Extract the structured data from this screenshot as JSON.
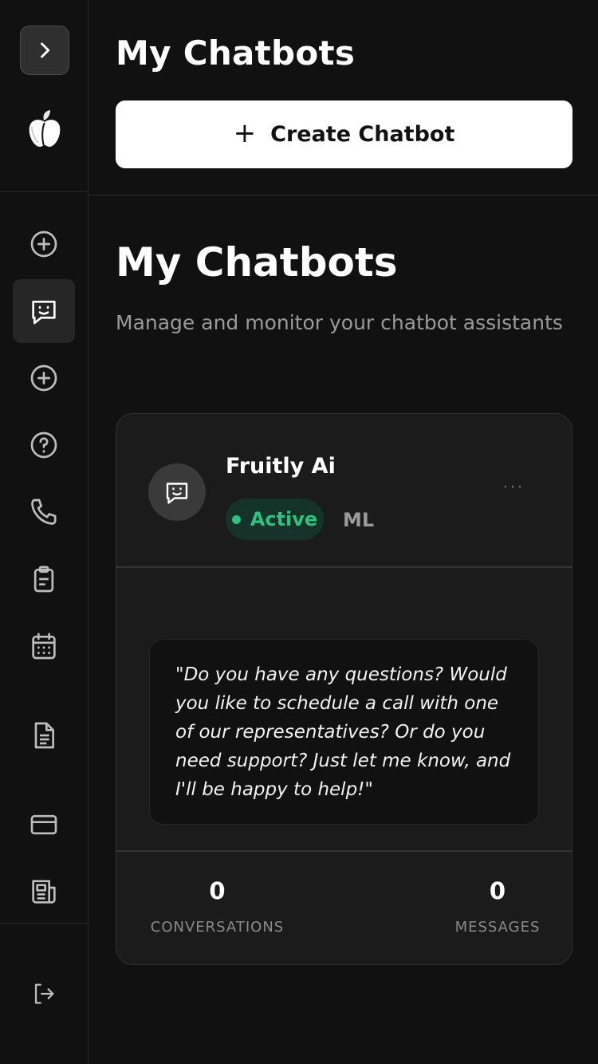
{
  "sidebar": {
    "expand_icon": "chevron-right-icon",
    "logo_icon": "apple-logo",
    "nav_items": [
      {
        "icon": "plus-circle-icon"
      },
      {
        "icon": "chat-smile-icon",
        "active": true
      },
      {
        "icon": "plus-circle-icon"
      },
      {
        "icon": "help-circle-icon"
      },
      {
        "icon": "phone-icon"
      },
      {
        "icon": "clipboard-icon"
      },
      {
        "icon": "calendar-icon"
      },
      {
        "icon": "document-icon"
      },
      {
        "icon": "credit-card-icon"
      },
      {
        "icon": "newspaper-icon"
      },
      {
        "icon": "logout-icon"
      }
    ]
  },
  "header": {
    "title": "My Chatbots",
    "create_button_icon": "+",
    "create_button_label": "Create Chatbot"
  },
  "main": {
    "title": "My Chatbots",
    "subtitle": "Manage and monitor your chatbot assistants"
  },
  "chatbot": {
    "name": "Fruitly Ai",
    "status": "Active",
    "tag": "ML",
    "more_label": "···",
    "greeting": "\"Do you have any questions? Would you like to schedule a call with one of our representatives? Or do you need support? Just let me know, and I'll be happy to help!\"",
    "conversations_count": "0",
    "conversations_label": "CONVERSATIONS",
    "messages_count": "0",
    "messages_label": "MESSAGES"
  },
  "colors": {
    "background": "#111111",
    "card": "#1b1b1b",
    "accent_green": "#2ec27e",
    "muted_text": "#9a9a9a"
  }
}
